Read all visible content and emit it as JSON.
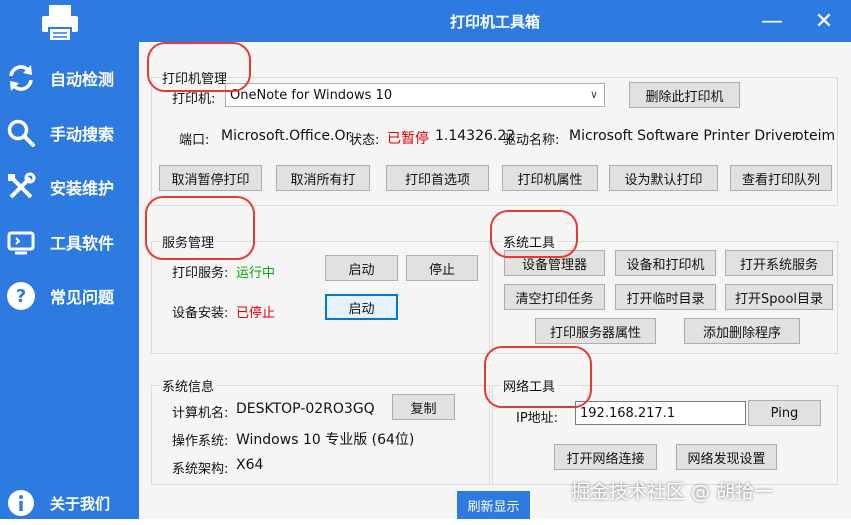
{
  "window": {
    "title": "打印机工具箱",
    "minimize_glyph": "—",
    "close_glyph": "✕"
  },
  "sidebar": {
    "items": [
      {
        "label": "自动检测",
        "icon": "refresh-icon"
      },
      {
        "label": "手动搜索",
        "icon": "search-icon"
      },
      {
        "label": "安装维护",
        "icon": "tools-icon"
      },
      {
        "label": "工具软件",
        "icon": "monitor-icon"
      },
      {
        "label": "常见问题",
        "icon": "question-icon"
      },
      {
        "label": "关于我们",
        "icon": "info-icon"
      }
    ],
    "colors": {
      "bg": "#2d7be0"
    }
  },
  "printer_mgmt": {
    "title": "打印机管理",
    "printer_label": "打印机:",
    "printer_selected": "OneNote for Windows 10",
    "delete_button": "删除此打印机",
    "port_label": "端口:",
    "port_value": "Microsoft.Office.Or",
    "status_label": "状态:",
    "status_value": "已暂停",
    "status_extra": "1.14326.22",
    "driver_label": "驱动名称:",
    "driver_value": "Microsoft Software Printer Driver",
    "driver_extra": "oteim",
    "buttons": [
      "取消暂停打印",
      "取消所有打",
      "打印首选项",
      "打印机属性",
      "设为默认打印",
      "查看打印队列"
    ]
  },
  "service_mgmt": {
    "title": "服务管理",
    "print_service_label": "打印服务:",
    "print_service_status": "运行中",
    "start_label": "启动",
    "stop_label": "停止",
    "device_install_label": "设备安装:",
    "device_install_status": "已停止",
    "device_start_label": "启动"
  },
  "system_tools": {
    "title": "系统工具",
    "buttons": [
      "设备管理器",
      "设备和打印机",
      "打开系统服务",
      "清空打印任务",
      "打开临时目录",
      "打开Spool目录",
      "打印服务器属性",
      "添加删除程序"
    ]
  },
  "system_info": {
    "title": "系统信息",
    "computer_label": "计算机名:",
    "computer_value": "DESKTOP-02RO3GQ",
    "copy_button": "复制",
    "os_label": "操作系统:",
    "os_value": "Windows 10 专业版 (64位)",
    "arch_label": "系统架构:",
    "arch_value": "X64"
  },
  "network_tools": {
    "title": "网络工具",
    "ip_label": "IP地址:",
    "ip_value": "192.168.217.1",
    "ping_button": "Ping",
    "open_conn_button": "打开网络连接",
    "discovery_button": "网络发现设置"
  },
  "refresh_button": "刷新显示",
  "watermark": "掘金技术社区 @ 胡拾一",
  "colors": {
    "accent": "#2d7be0",
    "error": "#e00000",
    "ok": "#10a010",
    "annotation": "#e53935"
  }
}
